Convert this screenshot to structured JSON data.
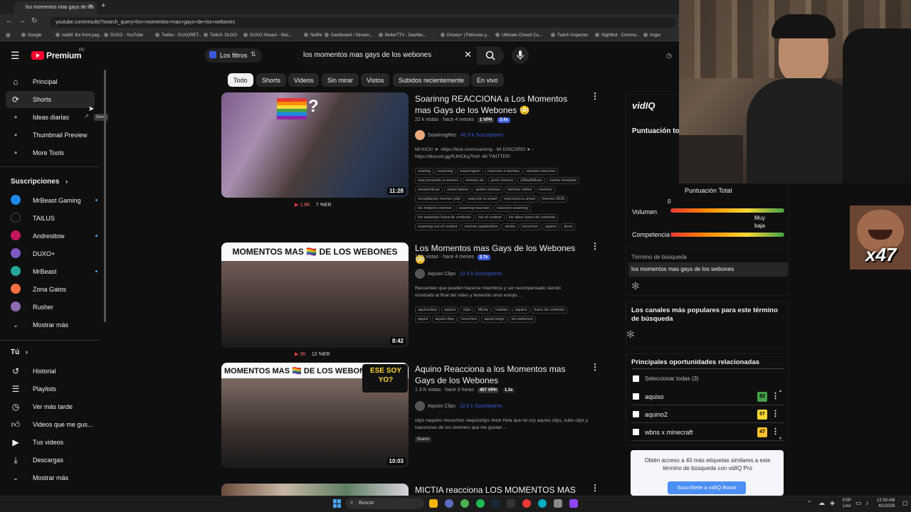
{
  "browser": {
    "tab_title": "los momentos mas gays de los",
    "url": "youtube.com/results?search_query=los+momentos+mas+gays+de+los+webones",
    "bookmarks": [
      "Google",
      "reddit: the front pag...",
      "DUXO - YouTube",
      "Twitter - DUXORET...",
      "Twitch- DUXO",
      "DUXO Stream - Wat...",
      "Netflix",
      "Dashboard / Stream...",
      "BetterTTV - Dashbo...",
      "Disney+ | Películas y...",
      "Ultimate Closed Ca...",
      "Twitch Inspector",
      "Nightbot - Comma...",
      "Imgur"
    ]
  },
  "header": {
    "logo_text": "Premium",
    "logo_region": "PE",
    "filters_label": "Los filtros",
    "search_value": "los momentos mas gays de los webones"
  },
  "chips": [
    "Todo",
    "Shorts",
    "Videos",
    "Sin mirar",
    "Vistos",
    "Subidos recientemente",
    "En vivo"
  ],
  "sidebar": {
    "main": [
      {
        "label": "Principal",
        "icon": "home-icon"
      },
      {
        "label": "Shorts",
        "icon": "shorts-icon"
      },
      {
        "label": "Ideas diarias",
        "icon": "vidiq-icon"
      },
      {
        "label": "Thumbnail Preview",
        "icon": "vidiq-icon"
      },
      {
        "label": "More Tools",
        "icon": "vidiq-icon"
      }
    ],
    "tooltip": "Shorts",
    "subs_header": "Suscripciones",
    "subs": [
      {
        "label": "MrBeast Gaming",
        "live": true,
        "color": "#1e88e5"
      },
      {
        "label": "TAILUS",
        "live": false,
        "color": "#111111"
      },
      {
        "label": "Andresitow",
        "live": true,
        "color": "#c2185b"
      },
      {
        "label": "DUXO+",
        "live": false,
        "color": "#7e57c2"
      },
      {
        "label": "MrBeast",
        "live": true,
        "color": "#26a69a"
      },
      {
        "label": "Zona Gatos",
        "live": false,
        "color": "#ff7043"
      },
      {
        "label": "Rusher",
        "live": false,
        "color": "#8e6bb0"
      }
    ],
    "show_more": "Mostrar más",
    "you_header": "Tú",
    "you": [
      {
        "label": "Historial",
        "icon": "history-icon"
      },
      {
        "label": "Playlists",
        "icon": "playlist-icon"
      },
      {
        "label": "Ver más tarde",
        "icon": "clock-icon"
      },
      {
        "label": "Videos que me gus...",
        "icon": "thumbs-up-icon"
      },
      {
        "label": "Tus videos",
        "icon": "video-icon"
      },
      {
        "label": "Descargas",
        "icon": "download-icon"
      },
      {
        "label": "Mostrar más",
        "icon": "chevron-down-icon"
      }
    ]
  },
  "videos": [
    {
      "title": "Soarinng REACCIONA a Los Momentos mas Gays de los Webones 😳",
      "meta": "22 k vistas · hace 4 meses",
      "vph": "1 VPH",
      "score": "3.4x",
      "channel": "SoarinngRec",
      "subs": "42.6 k Suscriptores",
      "desc": "MI KICK! ➤ -https://kick.com/soarinng - MI DISCORD! ➤ -https://discord.gg/RJHCKq7hv9 -MI TWITTER!",
      "tags": [
        "soaring",
        "soarinng",
        "soarinngrec",
        "reaccion a memes",
        "memes reaccion",
        "reaccionando a memes",
        "memes de",
        "junio memes",
        "UMadWilson",
        "meme template",
        "umadcriticas",
        "umad wilson",
        "anime memes",
        "memes roblox",
        "memes",
        "recopilacion memes julio",
        "reaccion a umad",
        "reacciona a umad",
        "memes 2025",
        "los mejores memes",
        "soarinng reaccion",
        "reaccion soarinng",
        "los webones fuera de contexto",
        "out of context",
        "los wbns fuera de contexto",
        "soarinng out of context",
        "memes septiembre",
        "mictia",
        "locochon",
        "aquino",
        "duxo"
      ],
      "duration": "11:28",
      "stat1": "1.8K",
      "stat2": "7 %ER"
    },
    {
      "title": "Los Momentos mas Gays de los Webones 😳",
      "meta": "15 k vistas · hace 4 meses",
      "score": "2.7x",
      "channel": "Aquiso Clips",
      "subs": "22.6 k Suscriptores",
      "desc": "Recuerden que pueden hacerse miembros y ser recompensado siendo mostrado al final del video y teniendo unos emojis ...",
      "tags": [
        "aquisoclips",
        "aquiso",
        "clips",
        "Mictia",
        "natalan",
        "aquino",
        "fuera de contexto",
        "aquisi",
        "aquisi clips",
        "locochon",
        "aquisi largo",
        "los webones"
      ],
      "duration": "8:42",
      "thumb_text": "MOMENTOS MAS 🏳️‍🌈 DE LOS WEBONES",
      "stat1": "2K",
      "stat2": "12 %ER"
    },
    {
      "title": "Aquino Reacciona a los Momentos mas Gays de los Webones",
      "meta": "1.3 K vistas · hace 3 horas",
      "vph": "457 VPH",
      "score": "1.3x",
      "channel": "Aquiso Clips",
      "subs": "22.6 k Suscriptores",
      "desc": "clips #aquino #locochon #aquisiclips #kick Hola que tal soy aquiso clips, subo clips y reacciones de los stremers que me gustan ...",
      "new_badge": "Nuevo",
      "duration": "10:03",
      "thumb_text": "MOMENTOS MAS 🏳️‍🌈 DE LOS WEBONES",
      "thumb_text2": "ESE SOY YO?"
    },
    {
      "title": "MICTIA reacciona LOS MOMENTOS MAS"
    }
  ],
  "vidiq": {
    "logo": "vidIQ",
    "score_title": "Puntuación tota",
    "score_label": "Puntuación Total",
    "volume_label": "Volumen",
    "volume_value": "0",
    "volume_level": 0.0,
    "competition_label": "Competencia",
    "competition_value": "Muy baja",
    "competition_level": 0.82,
    "term_label": "Término de búsqueda",
    "term_value": "los momentos mas gays de los webones",
    "popular_channels": "Los canales más populares para este término de búsqueda",
    "opps_title": "Principales oportunidades relacionadas",
    "select_all": "Seleccionar todas (3)",
    "opps": [
      {
        "label": "aquiso",
        "score": "62",
        "color": "#43a047"
      },
      {
        "label": "aquino2",
        "score": "57",
        "color": "#fdd835"
      },
      {
        "label": "wbns x minecraft",
        "score": "47",
        "color": "#fbc02d"
      }
    ],
    "promo": "Obtén acceso a 40 más etiquetas similares a este término de búsqueda con vidIQ Pro",
    "promo_button": "Suscríbete a vidIQ Boost"
  },
  "emote": {
    "text": "x47"
  },
  "taskbar": {
    "search": "Buscar",
    "lang": "ESP",
    "region": "LAA",
    "time": "12:33 AM",
    "date": "4/1/2026"
  }
}
